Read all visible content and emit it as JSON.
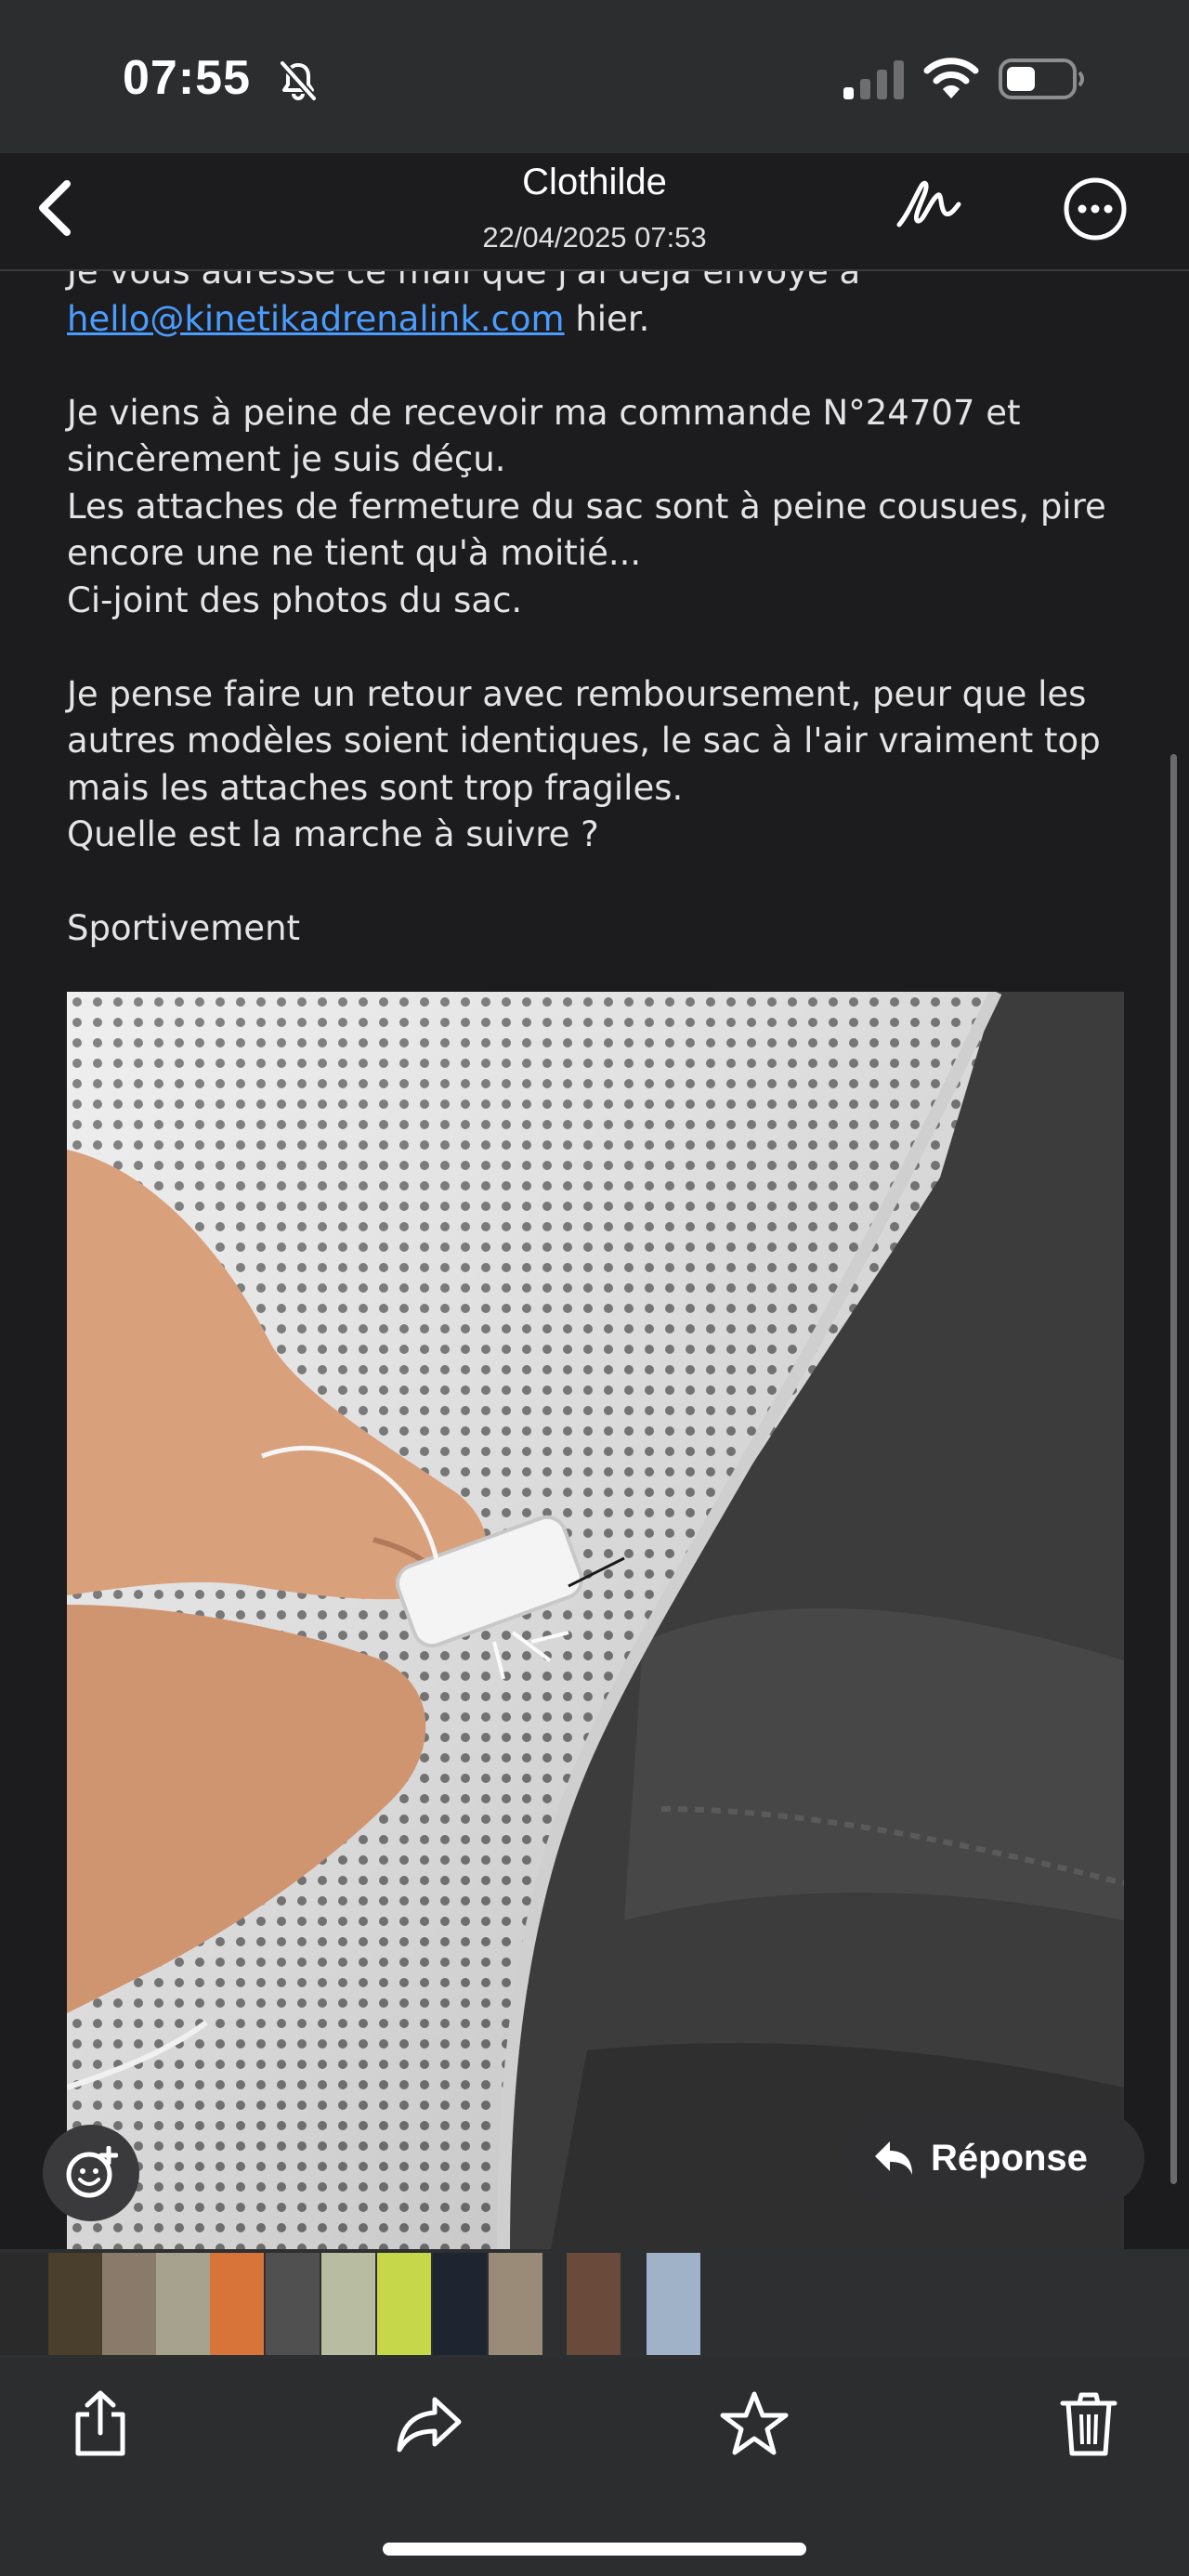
{
  "status_bar": {
    "time": "07:55",
    "icons": [
      "bell-slash-icon",
      "cellular-signal-icon",
      "wifi-icon",
      "battery-icon"
    ]
  },
  "header": {
    "sender": "Clothilde",
    "date": "22/04/2025 07:53",
    "icons": [
      "chevron-left-icon",
      "signature-icon",
      "more-icon"
    ]
  },
  "message": {
    "intro": "Je vous adresse ce mail que j'ai déjà envoyé à",
    "link": "hello@kinetikadrenalink.com",
    "link_suffix": " hier.",
    "paragraph_1": "Je viens à peine de recevoir ma commande N°24707 et sincèrement je suis déçu.\nLes attaches de fermeture du sac sont à peine cousues, pire encore une ne tient qu'à moitié...\nCi-joint des photos du sac.",
    "paragraph_2": "Je pense faire un retour avec remboursement, peur que les autres modèles soient identiques, le sac à l'air vraiment top mais les attaches sont trop fragiles.\nQuelle est la marche à suivre ?",
    "closing": "Sportivement"
  },
  "actions": {
    "reply_label": "Réponse",
    "emoji_icon": "emoji-add-icon",
    "reply_icon": "reply-arrow-icon"
  },
  "toolbar": {
    "icons": [
      "share-icon",
      "forward-icon",
      "star-icon",
      "trash-icon"
    ]
  },
  "colors": {
    "background": "#1c1c1e",
    "bars": "#2b2d2f",
    "link": "#4a9cff",
    "text": "#e4e4e4"
  }
}
